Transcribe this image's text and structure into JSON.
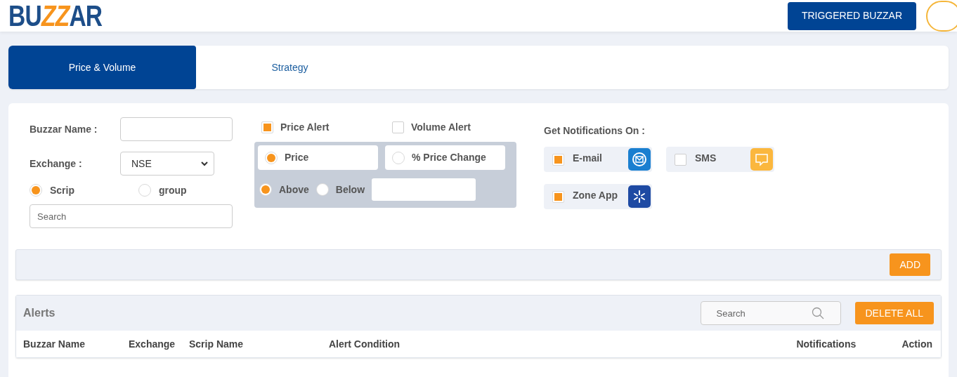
{
  "header": {
    "logo": [
      {
        "text": "BU",
        "accent": false
      },
      {
        "text": "ZZ",
        "accent": true
      },
      {
        "text": "AR",
        "accent": false
      }
    ],
    "triggered_button": "TRIGGERED BUZZAR"
  },
  "tabs": [
    {
      "label": "Price & Volume",
      "selected": true
    },
    {
      "label": "Strategy",
      "selected": false
    }
  ],
  "form": {
    "buzzar_name": {
      "label": "Buzzar Name :"
    },
    "exchange": {
      "label": "Exchange :",
      "value": "NSE"
    },
    "scope_options": [
      {
        "label": "Scrip",
        "selected": true
      },
      {
        "label": "group",
        "selected": false
      }
    ],
    "search": {
      "placeholder": "Search"
    },
    "alert_types": [
      {
        "label": "Price Alert",
        "checked": true
      },
      {
        "label": "Volume Alert",
        "checked": false
      }
    ],
    "price_modes": [
      {
        "label": "Price",
        "selected": true
      },
      {
        "label": "% Price Change",
        "selected": false
      }
    ],
    "directions": [
      {
        "label": "Above",
        "selected": true
      },
      {
        "label": "Below",
        "selected": false
      }
    ],
    "notifications": {
      "title": "Get Notifications On :",
      "channels": [
        {
          "label": "E-mail",
          "checked": true,
          "kind": "email"
        },
        {
          "label": "SMS",
          "checked": false,
          "kind": "sms"
        },
        {
          "label": "Zone App",
          "checked": true,
          "kind": "app"
        }
      ]
    },
    "add_button": "ADD"
  },
  "alerts": {
    "title": "Alerts",
    "search": {
      "placeholder": "Search"
    },
    "delete_button": "DELETE ALL",
    "columns": [
      "Buzzar Name",
      "Exchange",
      "Scrip Name",
      "Alert Condition",
      "Notifications",
      "Action"
    ]
  }
}
